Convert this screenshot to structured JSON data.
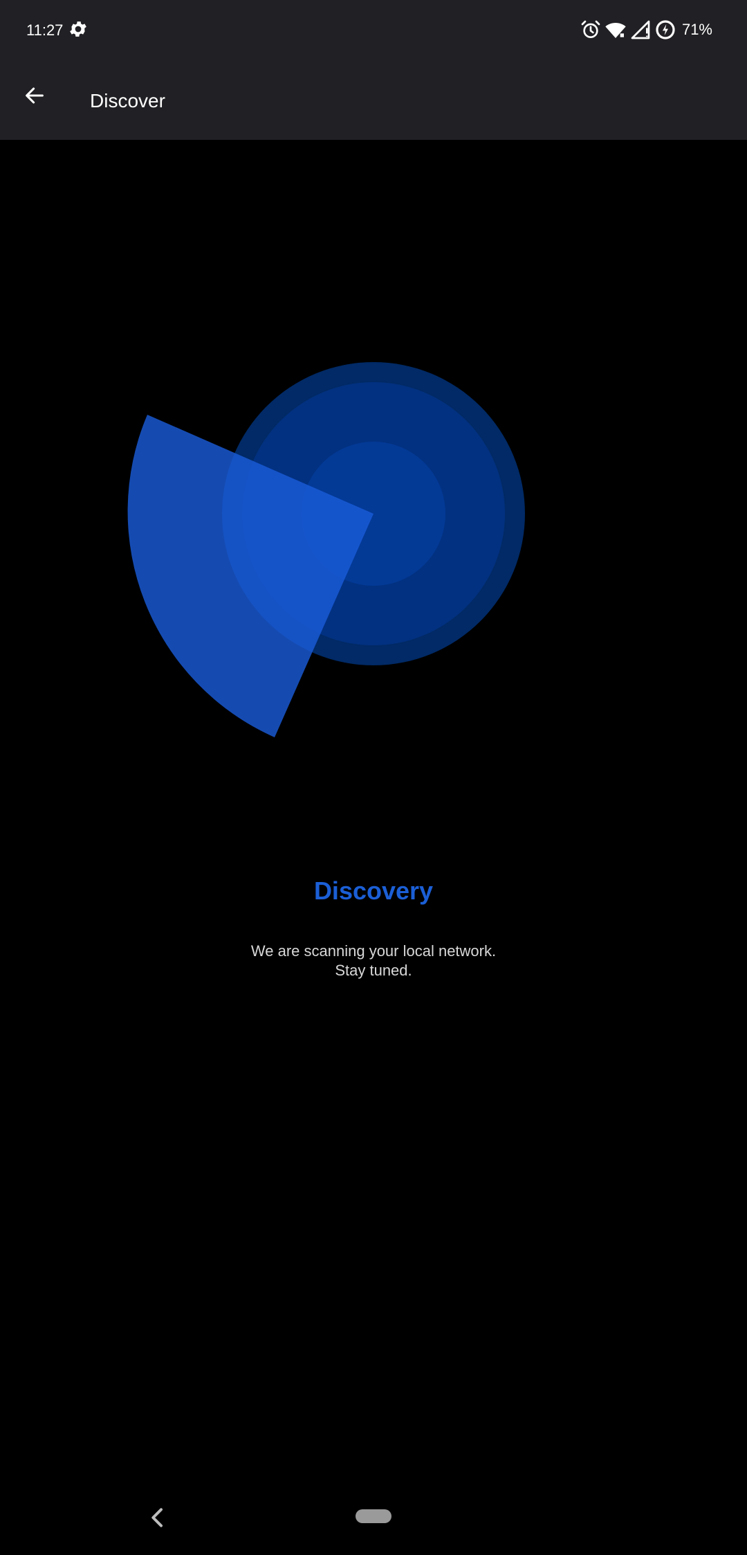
{
  "status_bar": {
    "time": "11:27",
    "battery": "71%",
    "icons": [
      "gear-icon",
      "alarm-icon",
      "wifi-icon",
      "signal-icon",
      "battery-saver-icon"
    ]
  },
  "app_bar": {
    "title": "Discover",
    "back_icon": "arrow-back-icon"
  },
  "main": {
    "heading": "Discovery",
    "description_line1": "We are scanning your local network.",
    "description_line2": "Stay tuned."
  },
  "nav_bar": {
    "icons": [
      "nav-back-icon",
      "home-pill-icon"
    ]
  },
  "colors": {
    "background": "#000000",
    "bar": "#212024",
    "accent": "#1b5fd6",
    "radar_outer": "#012a66",
    "radar_mid": "#023181",
    "radar_inner": "#033a96",
    "sweep": "#1a5bd8"
  }
}
